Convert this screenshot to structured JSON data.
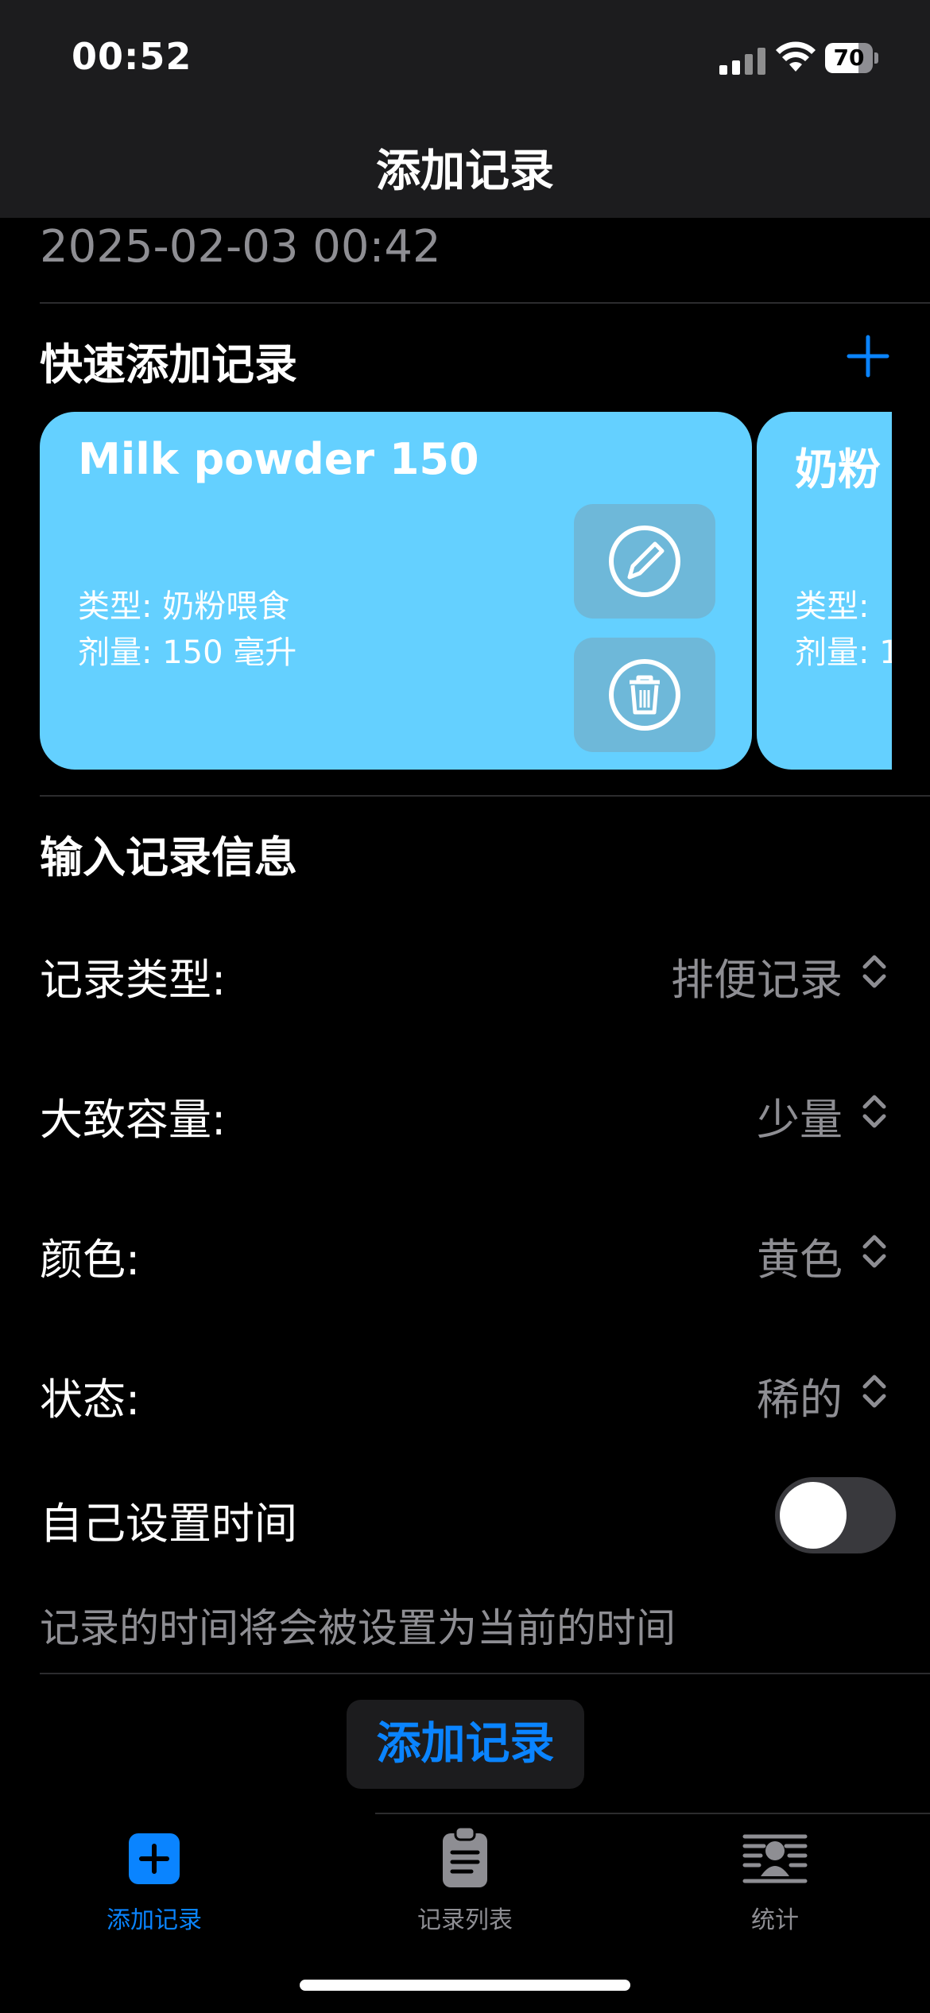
{
  "status_bar": {
    "time": "00:52",
    "battery": "70"
  },
  "nav": {
    "title": "添加记录"
  },
  "date_value": "2025-02-03 00:42",
  "quick_add": {
    "title": "快速添加记录",
    "cards": [
      {
        "title": "Milk powder 150",
        "type_line": "类型:  奶粉喂食",
        "dose_line": "剂量: 150 毫升"
      },
      {
        "title": "奶粉",
        "type_line": "类型:",
        "dose_line": "剂量: 1"
      }
    ]
  },
  "form": {
    "title": "输入记录信息",
    "rows": [
      {
        "label": "记录类型:",
        "value": "排便记录"
      },
      {
        "label": "大致容量:",
        "value": "少量"
      },
      {
        "label": "颜色:",
        "value": "黄色"
      },
      {
        "label": "状态:",
        "value": "稀的"
      }
    ],
    "custom_time": {
      "label": "自己设置时间",
      "on": false
    },
    "hint": "记录的时间将会被设置为当前的时间",
    "submit_label": "添加记录"
  },
  "tabs": [
    {
      "label": "添加记录",
      "icon": "plus-square-icon",
      "active": true
    },
    {
      "label": "记录列表",
      "icon": "clipboard-icon",
      "active": false
    },
    {
      "label": "统计",
      "icon": "person-chart-icon",
      "active": false
    }
  ],
  "colors": {
    "accent": "#0a84ff",
    "card": "#64d0ff",
    "secondary_text": "#8e8e93"
  }
}
